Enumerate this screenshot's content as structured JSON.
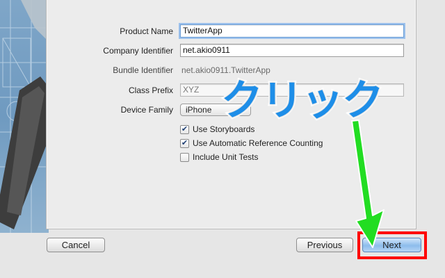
{
  "form": {
    "product_name_label": "Product Name",
    "product_name_value": "TwitterApp",
    "company_identifier_label": "Company Identifier",
    "company_identifier_value": "net.akio0911",
    "bundle_identifier_label": "Bundle Identifier",
    "bundle_identifier_value": "net.akio0911.TwitterApp",
    "class_prefix_label": "Class Prefix",
    "class_prefix_value": "XYZ",
    "device_family_label": "Device Family",
    "device_family_value": "iPhone",
    "use_storyboards_label": "Use Storyboards",
    "use_storyboards_checked": true,
    "use_arc_label": "Use Automatic Reference Counting",
    "use_arc_checked": true,
    "include_unit_tests_label": "Include Unit Tests",
    "include_unit_tests_checked": false
  },
  "footer": {
    "cancel_label": "Cancel",
    "previous_label": "Previous",
    "next_label": "Next"
  },
  "annotation": {
    "callout_text": "クリック",
    "callout_color": "#1e8ee8",
    "arrow_color": "#22dd22",
    "highlight_color": "#ff0000"
  },
  "icons": {
    "checkmark": "✔",
    "select_chevron": "⬍"
  }
}
